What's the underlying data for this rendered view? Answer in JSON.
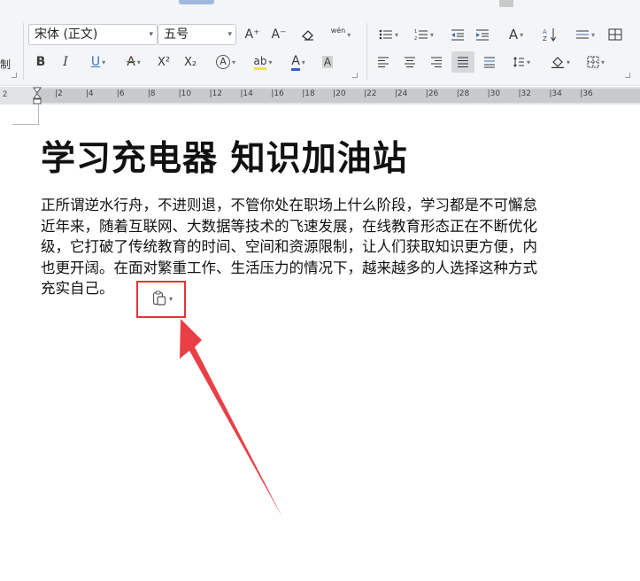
{
  "font": {
    "family_value": "宋体 (正文)",
    "size_value": "五号"
  },
  "ribbon": {
    "left_clip_label": "制",
    "grow_font_label": "A⁺",
    "shrink_font_label": "A⁻",
    "phonetic_label": "wén",
    "bold_label": "B",
    "italic_label": "I",
    "underline_label": "U",
    "strike_label": "A",
    "superscript_label": "X²",
    "subscript_label": "X₂",
    "effect_label": "A",
    "highlight_label": "ab",
    "font_color_label": "A",
    "char_shade_label": "A",
    "char_scale_label": "A"
  },
  "ruler": {
    "left_number": "2",
    "marks": [
      "2",
      "4",
      "6",
      "8",
      "10",
      "12",
      "14",
      "16",
      "18",
      "20",
      "22",
      "24",
      "26",
      "28",
      "30",
      "32",
      "34",
      "36"
    ]
  },
  "document": {
    "title": "学习充电器 知识加油站",
    "body_lines": [
      "正所谓逆水行舟，不进则退，不管你处在职场上什么阶段，学习都是不可懈怠",
      "近年来，随着互联网、大数据等技术的飞速发展，在线教育形态正在不断优化",
      "级，它打破了传统教育的时间、空间和资源限制，让人们获取知识更方便，内",
      "也更开阔。在面对繁重工作、生活压力的情况下，越来越多的人选择这种方式",
      "充实自己。"
    ]
  },
  "colors": {
    "highlight_box": "#e5333b",
    "arrow": "#ea3f46",
    "active_button_bg": "#d5d8dd"
  }
}
